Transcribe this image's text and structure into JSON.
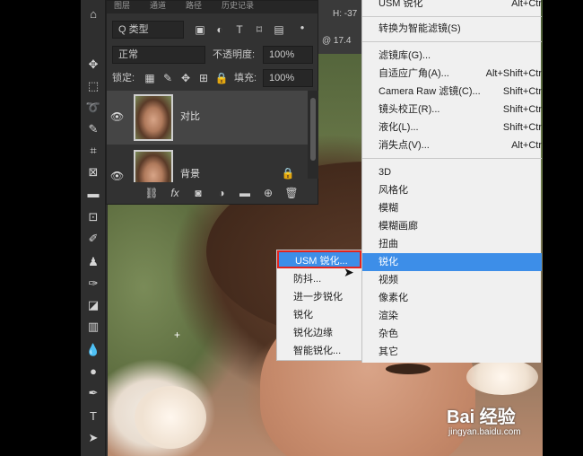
{
  "title_bar": {
    "zoom_fragment": "@ 17.4",
    "h_fragment": "H: -37"
  },
  "layers_panel": {
    "tabs": [
      "图层",
      "通道",
      "路径",
      "历史记录"
    ],
    "filter_kind": "Q 类型",
    "blend_mode": "正常",
    "opacity_label": "不透明度:",
    "opacity_value": "100%",
    "lock_label": "锁定:",
    "fill_label": "填充:",
    "fill_value": "100%",
    "layers": [
      {
        "name": "对比",
        "selected": true
      },
      {
        "name": "背景",
        "selected": false
      }
    ],
    "bottom_fx": "fx"
  },
  "filter_menu": {
    "items": [
      {
        "label": "USM 锐化",
        "shortcut": "Alt+Ctr"
      },
      {
        "label": "转换为智能滤镜(S)",
        "shortcut": ""
      },
      {
        "label": "滤镜库(G)...",
        "shortcut": ""
      },
      {
        "label": "自适应广角(A)...",
        "shortcut": "Alt+Shift+Ctr"
      },
      {
        "label": "Camera Raw 滤镜(C)...",
        "shortcut": "Shift+Ctr"
      },
      {
        "label": "镜头校正(R)...",
        "shortcut": "Shift+Ctr"
      },
      {
        "label": "液化(L)...",
        "shortcut": "Shift+Ctr"
      },
      {
        "label": "消失点(V)...",
        "shortcut": "Alt+Ctr"
      },
      {
        "label": "3D",
        "shortcut": ""
      },
      {
        "label": "风格化",
        "shortcut": ""
      },
      {
        "label": "模糊",
        "shortcut": ""
      },
      {
        "label": "模糊画廊",
        "shortcut": ""
      },
      {
        "label": "扭曲",
        "shortcut": ""
      },
      {
        "label": "锐化",
        "shortcut": ""
      },
      {
        "label": "视频",
        "shortcut": ""
      },
      {
        "label": "像素化",
        "shortcut": ""
      },
      {
        "label": "渲染",
        "shortcut": ""
      },
      {
        "label": "杂色",
        "shortcut": ""
      },
      {
        "label": "其它",
        "shortcut": ""
      }
    ],
    "highlighted": "锐化"
  },
  "sharpen_submenu": {
    "items": [
      "USM 锐化...",
      "防抖...",
      "进一步锐化",
      "锐化",
      "锐化边缘",
      "智能锐化..."
    ],
    "highlighted": "USM 锐化..."
  },
  "watermark": {
    "brand": "Bai 经验",
    "url": "jingyan.baidu.com"
  },
  "colors": {
    "menu_bg": "#f0f0f0",
    "highlight": "#3d8ee8",
    "selection_border": "#e2241f",
    "panel_bg": "#323232"
  }
}
